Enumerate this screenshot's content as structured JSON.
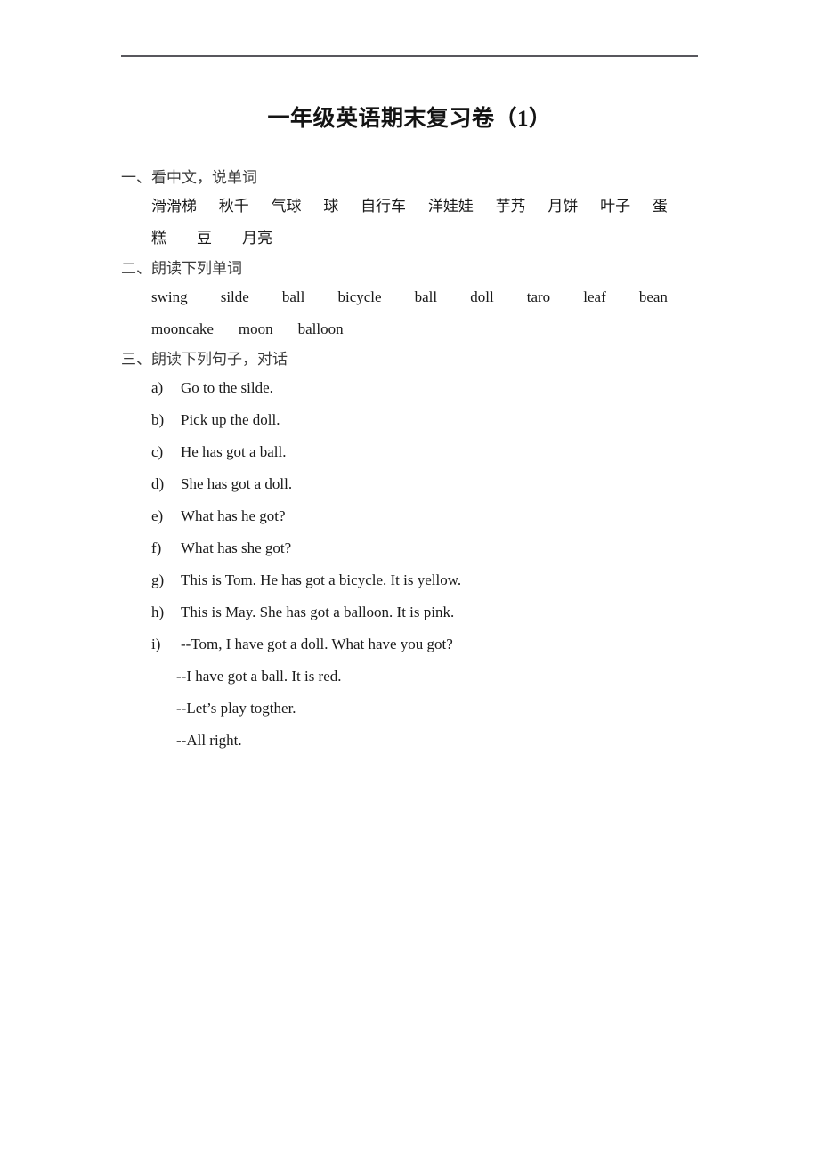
{
  "document": {
    "title": "一年级英语期末复习卷（1）",
    "has_header_rule": true,
    "rule_color": "#58575d",
    "text_color": "#1a1a1a"
  },
  "sections": [
    {
      "heading": "一、看中文，说单词",
      "type": "word-list",
      "lines": [
        [
          "滑滑梯",
          "秋千",
          "气球",
          "球",
          "自行车",
          "洋娃娃",
          "芋艿",
          "月饼",
          "叶子",
          "蛋"
        ],
        [
          "糕",
          "豆",
          "月亮"
        ]
      ]
    },
    {
      "heading": "二、朗读下列单词",
      "type": "word-list",
      "lines": [
        [
          "swing",
          "silde",
          "ball",
          "bicycle",
          "ball",
          "doll",
          "taro",
          "leaf",
          "bean"
        ],
        [
          "mooncake",
          "moon",
          "balloon"
        ]
      ]
    },
    {
      "heading": "三、朗读下列句子，对话",
      "type": "sentence-list",
      "items": [
        {
          "marker": "a)",
          "text": "Go to the silde."
        },
        {
          "marker": "b)",
          "text": "Pick up the doll."
        },
        {
          "marker": "c)",
          "text": "He has got a ball."
        },
        {
          "marker": "d)",
          "text": "She has got a doll."
        },
        {
          "marker": "e)",
          "text": "What has he got?"
        },
        {
          "marker": "f)",
          "text": "What has she got?"
        },
        {
          "marker": "g)",
          "text": "This is Tom. He has got a bicycle. It is yellow."
        },
        {
          "marker": "h)",
          "text": "This is May. She has got a balloon. It is pink."
        },
        {
          "marker": "i)",
          "text": "--Tom, I have got a doll. What have you got?"
        }
      ],
      "dialogue_continuations": [
        "--I have got a ball. It is red.",
        "--Let’s play togther.",
        "--All right."
      ]
    }
  ]
}
